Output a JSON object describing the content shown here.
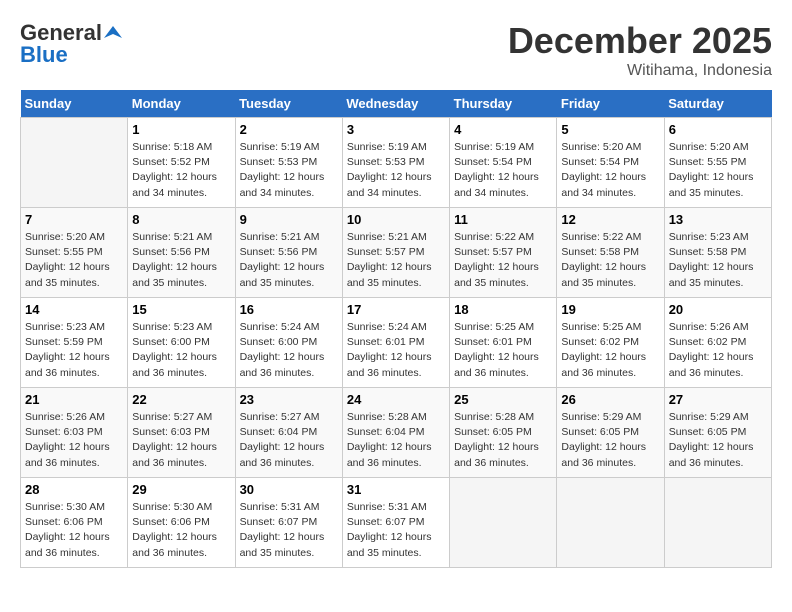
{
  "header": {
    "logo_line1": "General",
    "logo_line2": "Blue",
    "month": "December 2025",
    "location": "Witihama, Indonesia"
  },
  "weekdays": [
    "Sunday",
    "Monday",
    "Tuesday",
    "Wednesday",
    "Thursday",
    "Friday",
    "Saturday"
  ],
  "weeks": [
    [
      {
        "day": null
      },
      {
        "day": "1",
        "sunrise": "5:18 AM",
        "sunset": "5:52 PM",
        "daylight": "12 hours and 34 minutes."
      },
      {
        "day": "2",
        "sunrise": "5:19 AM",
        "sunset": "5:53 PM",
        "daylight": "12 hours and 34 minutes."
      },
      {
        "day": "3",
        "sunrise": "5:19 AM",
        "sunset": "5:53 PM",
        "daylight": "12 hours and 34 minutes."
      },
      {
        "day": "4",
        "sunrise": "5:19 AM",
        "sunset": "5:54 PM",
        "daylight": "12 hours and 34 minutes."
      },
      {
        "day": "5",
        "sunrise": "5:20 AM",
        "sunset": "5:54 PM",
        "daylight": "12 hours and 34 minutes."
      },
      {
        "day": "6",
        "sunrise": "5:20 AM",
        "sunset": "5:55 PM",
        "daylight": "12 hours and 35 minutes."
      }
    ],
    [
      {
        "day": "7",
        "sunrise": "5:20 AM",
        "sunset": "5:55 PM",
        "daylight": "12 hours and 35 minutes."
      },
      {
        "day": "8",
        "sunrise": "5:21 AM",
        "sunset": "5:56 PM",
        "daylight": "12 hours and 35 minutes."
      },
      {
        "day": "9",
        "sunrise": "5:21 AM",
        "sunset": "5:56 PM",
        "daylight": "12 hours and 35 minutes."
      },
      {
        "day": "10",
        "sunrise": "5:21 AM",
        "sunset": "5:57 PM",
        "daylight": "12 hours and 35 minutes."
      },
      {
        "day": "11",
        "sunrise": "5:22 AM",
        "sunset": "5:57 PM",
        "daylight": "12 hours and 35 minutes."
      },
      {
        "day": "12",
        "sunrise": "5:22 AM",
        "sunset": "5:58 PM",
        "daylight": "12 hours and 35 minutes."
      },
      {
        "day": "13",
        "sunrise": "5:23 AM",
        "sunset": "5:58 PM",
        "daylight": "12 hours and 35 minutes."
      }
    ],
    [
      {
        "day": "14",
        "sunrise": "5:23 AM",
        "sunset": "5:59 PM",
        "daylight": "12 hours and 36 minutes."
      },
      {
        "day": "15",
        "sunrise": "5:23 AM",
        "sunset": "6:00 PM",
        "daylight": "12 hours and 36 minutes."
      },
      {
        "day": "16",
        "sunrise": "5:24 AM",
        "sunset": "6:00 PM",
        "daylight": "12 hours and 36 minutes."
      },
      {
        "day": "17",
        "sunrise": "5:24 AM",
        "sunset": "6:01 PM",
        "daylight": "12 hours and 36 minutes."
      },
      {
        "day": "18",
        "sunrise": "5:25 AM",
        "sunset": "6:01 PM",
        "daylight": "12 hours and 36 minutes."
      },
      {
        "day": "19",
        "sunrise": "5:25 AM",
        "sunset": "6:02 PM",
        "daylight": "12 hours and 36 minutes."
      },
      {
        "day": "20",
        "sunrise": "5:26 AM",
        "sunset": "6:02 PM",
        "daylight": "12 hours and 36 minutes."
      }
    ],
    [
      {
        "day": "21",
        "sunrise": "5:26 AM",
        "sunset": "6:03 PM",
        "daylight": "12 hours and 36 minutes."
      },
      {
        "day": "22",
        "sunrise": "5:27 AM",
        "sunset": "6:03 PM",
        "daylight": "12 hours and 36 minutes."
      },
      {
        "day": "23",
        "sunrise": "5:27 AM",
        "sunset": "6:04 PM",
        "daylight": "12 hours and 36 minutes."
      },
      {
        "day": "24",
        "sunrise": "5:28 AM",
        "sunset": "6:04 PM",
        "daylight": "12 hours and 36 minutes."
      },
      {
        "day": "25",
        "sunrise": "5:28 AM",
        "sunset": "6:05 PM",
        "daylight": "12 hours and 36 minutes."
      },
      {
        "day": "26",
        "sunrise": "5:29 AM",
        "sunset": "6:05 PM",
        "daylight": "12 hours and 36 minutes."
      },
      {
        "day": "27",
        "sunrise": "5:29 AM",
        "sunset": "6:05 PM",
        "daylight": "12 hours and 36 minutes."
      }
    ],
    [
      {
        "day": "28",
        "sunrise": "5:30 AM",
        "sunset": "6:06 PM",
        "daylight": "12 hours and 36 minutes."
      },
      {
        "day": "29",
        "sunrise": "5:30 AM",
        "sunset": "6:06 PM",
        "daylight": "12 hours and 36 minutes."
      },
      {
        "day": "30",
        "sunrise": "5:31 AM",
        "sunset": "6:07 PM",
        "daylight": "12 hours and 35 minutes."
      },
      {
        "day": "31",
        "sunrise": "5:31 AM",
        "sunset": "6:07 PM",
        "daylight": "12 hours and 35 minutes."
      },
      {
        "day": null
      },
      {
        "day": null
      },
      {
        "day": null
      }
    ]
  ]
}
